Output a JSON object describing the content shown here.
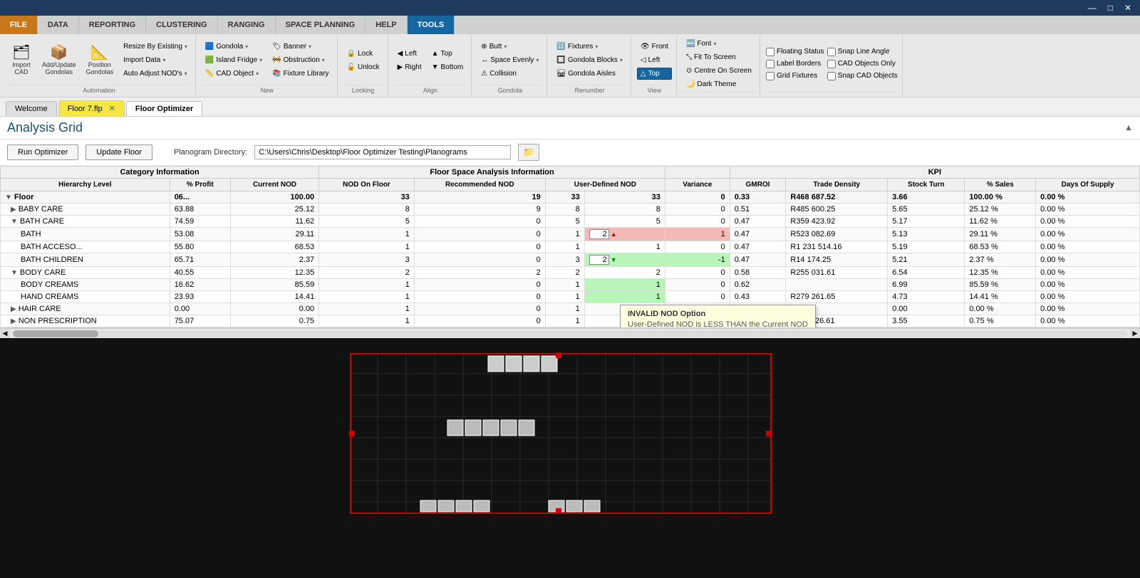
{
  "titlebar": {
    "minimize": "—",
    "maximize": "□",
    "close": "✕"
  },
  "ribbon": {
    "tabs": [
      {
        "id": "file",
        "label": "FILE",
        "style": "highlighted"
      },
      {
        "id": "data",
        "label": "DATA",
        "style": "normal"
      },
      {
        "id": "reporting",
        "label": "REPORTING",
        "style": "normal"
      },
      {
        "id": "clustering",
        "label": "CLUSTERING",
        "style": "normal"
      },
      {
        "id": "ranging",
        "label": "RANGING",
        "style": "normal"
      },
      {
        "id": "space_planning",
        "label": "SPACE PLANNING",
        "style": "normal"
      },
      {
        "id": "help",
        "label": "HELP",
        "style": "normal"
      },
      {
        "id": "tools",
        "label": "TOOLS",
        "style": "active"
      }
    ],
    "groups": {
      "automation": {
        "label": "Automation",
        "buttons": [
          {
            "id": "import_cad",
            "icon": "🗂",
            "label": "Import\nCAD"
          },
          {
            "id": "add_update_gondolas",
            "icon": "📦",
            "label": "Add/Update\nGondolas"
          },
          {
            "id": "position_gondolas",
            "icon": "📐",
            "label": "Position\nGondolas"
          }
        ],
        "dropdowns": [
          {
            "id": "resize_by_existing",
            "label": "Resize By Existing ▾"
          },
          {
            "id": "import_data",
            "label": "Import Data ▾"
          },
          {
            "id": "auto_adjust_nods",
            "label": "Auto Adjust NOD's ▾"
          }
        ]
      },
      "new": {
        "label": "New",
        "items": [
          {
            "id": "gondola",
            "icon": "🟦",
            "label": "Gondola ▾"
          },
          {
            "id": "island_fridge",
            "icon": "🟩",
            "label": "Island Fridge ▾"
          },
          {
            "id": "cad_object",
            "icon": "📏",
            "label": "CAD Object ▾"
          },
          {
            "id": "banner",
            "icon": "🏷",
            "label": "Banner ▾"
          },
          {
            "id": "obstruction",
            "icon": "🚧",
            "label": "Obstruction ▾"
          },
          {
            "id": "fixture_library",
            "icon": "📚",
            "label": "Fixture Library"
          }
        ]
      },
      "locking": {
        "label": "Locking",
        "items": [
          {
            "id": "lock",
            "icon": "🔒",
            "label": "Lock"
          },
          {
            "id": "unlock",
            "icon": "🔓",
            "label": "Unlock"
          }
        ]
      },
      "align": {
        "label": "Align",
        "items": [
          {
            "id": "left",
            "icon": "◀",
            "label": "Left"
          },
          {
            "id": "right",
            "icon": "▶",
            "label": "Right"
          },
          {
            "id": "top",
            "icon": "▲",
            "label": "Top"
          },
          {
            "id": "bottom",
            "icon": "▼",
            "label": "Bottom"
          }
        ]
      },
      "gondola_group": {
        "label": "Gondola",
        "items": [
          {
            "id": "butt",
            "icon": "⊕",
            "label": "Butt ▾"
          },
          {
            "id": "space_evenly",
            "icon": "↔",
            "label": "Space Evenly ▾"
          },
          {
            "id": "collision",
            "icon": "⚠",
            "label": "Collision"
          }
        ]
      },
      "renumber": {
        "label": "Renumber",
        "items": [
          {
            "id": "fixtures",
            "icon": "🔢",
            "label": "Fixtures ▾"
          },
          {
            "id": "gondola_blocks",
            "icon": "🔲",
            "label": "Gondola Blocks ▾"
          },
          {
            "id": "gondola_aisles",
            "icon": "🛤",
            "label": "Gondola Aisles"
          }
        ]
      },
      "view": {
        "label": "View",
        "items": [
          {
            "id": "front",
            "icon": "👁",
            "label": "Front"
          },
          {
            "id": "left_view",
            "icon": "◁",
            "label": "Left"
          },
          {
            "id": "top_active",
            "icon": "△",
            "label": "Top"
          }
        ]
      },
      "fit": {
        "label": "",
        "items": [
          {
            "id": "fit_to_screen",
            "label": "Fit To Screen"
          },
          {
            "id": "centre_on_screen",
            "label": "Centre On Screen"
          },
          {
            "id": "dark_theme",
            "label": "Dark Theme",
            "checked": true
          },
          {
            "id": "font",
            "label": "Font ▾"
          }
        ]
      },
      "checkboxes": {
        "items": [
          {
            "id": "floating_status",
            "label": "Floating Status",
            "checked": false
          },
          {
            "id": "snap_line_angle",
            "label": "Snap Line Angle",
            "checked": false
          },
          {
            "id": "label_borders",
            "label": "Label Borders",
            "checked": false
          },
          {
            "id": "cad_objects_only",
            "label": "CAD Objects Only",
            "checked": false
          },
          {
            "id": "grid_fixtures",
            "label": "Grid Fixtures",
            "checked": false
          },
          {
            "id": "snap_cad_objects",
            "label": "Snap CAD Objects",
            "checked": false
          }
        ]
      }
    }
  },
  "doctabs": {
    "tabs": [
      {
        "id": "welcome",
        "label": "Welcome",
        "closeable": false,
        "style": "normal"
      },
      {
        "id": "floor7",
        "label": "Floor 7.flp",
        "closeable": true,
        "style": "yellow"
      },
      {
        "id": "floor_optimizer",
        "label": "Floor Optimizer",
        "closeable": false,
        "style": "normal"
      }
    ]
  },
  "analysis_grid": {
    "title": "Analysis Grid",
    "run_optimizer_btn": "Run Optimizer",
    "update_floor_btn": "Update Floor",
    "planogram_directory_label": "Planogram Directory:",
    "planogram_directory_value": "C:\\Users\\Chris\\Desktop\\Floor Optimizer Testing\\Planograms",
    "column_groups": [
      {
        "label": "Category Information",
        "colspan": 3
      },
      {
        "label": "Floor Space Analysis Information",
        "colspan": 5
      },
      {
        "label": "",
        "colspan": 1
      },
      {
        "label": "KPI",
        "colspan": 6
      }
    ],
    "columns": [
      "Hierarchy Level",
      "% Profit",
      "Current NOD",
      "NOD On Floor",
      "Recommended NOD",
      "User-Defined NOD",
      "Variance",
      "GMROI",
      "Trade Density",
      "Stock Turn",
      "% Sales",
      "Days Of Supply"
    ],
    "rows": [
      {
        "id": "floor",
        "level": 0,
        "expand": "▼",
        "hierarchy": "Floor",
        "profit": "06...",
        "profit_val": "100.00",
        "current_nod": "33",
        "nod_on_floor": "19",
        "rec_nod": "33",
        "user_nod": "33",
        "variance": "0",
        "gmroi": "0.33",
        "trade_density": "R468 687.52",
        "stock_turn": "3.66",
        "pct_sales": "100.00 %",
        "days_supply": "0.00 %",
        "style": "floor"
      },
      {
        "id": "baby_care",
        "level": 1,
        "expand": "▶",
        "hierarchy": "BABY CARE",
        "profit": "63.88",
        "profit_val": "25.12",
        "current_nod": "8",
        "nod_on_floor": "9",
        "rec_nod": "8",
        "user_nod": "8",
        "variance": "0",
        "gmroi": "0.51",
        "trade_density": "R485 600.25",
        "stock_turn": "5.65",
        "pct_sales": "25.12 %",
        "days_supply": "0.00 %",
        "style": "normal"
      },
      {
        "id": "bath_care",
        "level": 1,
        "expand": "▼",
        "hierarchy": "BATH CARE",
        "profit": "74.59",
        "profit_val": "11.62",
        "current_nod": "5",
        "nod_on_floor": "0",
        "rec_nod": "5",
        "user_nod": "5",
        "variance": "0",
        "gmroi": "0.47",
        "trade_density": "R359 423.92",
        "stock_turn": "5.17",
        "pct_sales": "11.62 %",
        "days_supply": "0.00 %",
        "style": "normal"
      },
      {
        "id": "bath",
        "level": 2,
        "expand": "",
        "hierarchy": "BATH",
        "profit": "53.08",
        "profit_val": "29.11",
        "current_nod": "1",
        "nod_on_floor": "0",
        "rec_nod": "1",
        "user_nod": "2",
        "variance": "1",
        "gmroi": "0.47",
        "trade_density": "R523 082.69",
        "stock_turn": "5.13",
        "pct_sales": "29.11 %",
        "days_supply": "0.00 %",
        "style": "pink",
        "spin_up": true,
        "spin_type": "red"
      },
      {
        "id": "bath_acceso",
        "level": 2,
        "expand": "",
        "hierarchy": "BATH ACCESO...",
        "profit": "55.80",
        "profit_val": "68.53",
        "current_nod": "1",
        "nod_on_floor": "0",
        "rec_nod": "1",
        "user_nod": "1",
        "variance": "0",
        "gmroi": "0.47",
        "trade_density": "R1 231 514.16",
        "stock_turn": "5.19",
        "pct_sales": "68.53 %",
        "days_supply": "0.00 %",
        "style": "normal"
      },
      {
        "id": "bath_children",
        "level": 2,
        "expand": "",
        "hierarchy": "BATH CHILDREN",
        "profit": "65.71",
        "profit_val": "2.37",
        "current_nod": "3",
        "nod_on_floor": "0",
        "rec_nod": "3",
        "user_nod": "2",
        "variance": "-1",
        "gmroi": "0.47",
        "trade_density": "R14 174.25",
        "stock_turn": "5.21",
        "pct_sales": "2.37 %",
        "days_supply": "0.00 %",
        "style": "green",
        "spin_down": true,
        "spin_type": "green"
      },
      {
        "id": "body_care",
        "level": 1,
        "expand": "▼",
        "hierarchy": "BODY CARE",
        "profit": "40.55",
        "profit_val": "12.35",
        "current_nod": "2",
        "nod_on_floor": "2",
        "rec_nod": "2",
        "user_nod": "2",
        "variance": "0",
        "gmroi": "0.58",
        "trade_density": "R255 031.61",
        "stock_turn": "6.54",
        "pct_sales": "12.35 %",
        "days_supply": "0.00 %",
        "style": "normal"
      },
      {
        "id": "body_creams",
        "level": 2,
        "expand": "",
        "hierarchy": "BODY CREAMS",
        "profit": "16.62",
        "profit_val": "85.59",
        "current_nod": "1",
        "nod_on_floor": "0",
        "rec_nod": "1",
        "user_nod": "1",
        "variance": "0",
        "gmroi": "0.62",
        "trade_density": "",
        "stock_turn": "6.99",
        "pct_sales": "85.59 %",
        "days_supply": "0.00 %",
        "style": "green_light"
      },
      {
        "id": "hand_creams",
        "level": 2,
        "expand": "",
        "hierarchy": "HAND CREAMS",
        "profit": "23.93",
        "profit_val": "14.41",
        "current_nod": "1",
        "nod_on_floor": "0",
        "rec_nod": "1",
        "user_nod": "1",
        "variance": "0",
        "gmroi": "0.43",
        "trade_density": "R279 261.65",
        "stock_turn": "4.73",
        "pct_sales": "14.41 %",
        "days_supply": "0.00 %",
        "style": "green_light"
      },
      {
        "id": "hair_care",
        "level": 1,
        "expand": "▶",
        "hierarchy": "HAIR CARE",
        "profit": "0.00",
        "profit_val": "0.00",
        "current_nod": "1",
        "nod_on_floor": "0",
        "rec_nod": "1",
        "user_nod": "1",
        "variance": "0",
        "gmroi": "0.00",
        "trade_density": "R0.00",
        "stock_turn": "0.00",
        "pct_sales": "0.00 %",
        "days_supply": "0.00 %",
        "style": "normal"
      },
      {
        "id": "non_prescription",
        "level": 1,
        "expand": "▶",
        "hierarchy": "NON PRESCRIPTION",
        "profit": "75.07",
        "profit_val": "0.75",
        "current_nod": "1",
        "nod_on_floor": "0",
        "rec_nod": "1",
        "user_nod": "1",
        "variance": "0",
        "gmroi": "0.32",
        "trade_density": "R116 326.61",
        "stock_turn": "3.55",
        "pct_sales": "0.75 %",
        "days_supply": "0.00 %",
        "style": "normal"
      }
    ],
    "tooltip": {
      "title": "INVALID NOD Option",
      "body": "User-Defined NOD is LESS THAN the Current NOD"
    }
  },
  "floor_plan": {
    "background": "#111111"
  }
}
